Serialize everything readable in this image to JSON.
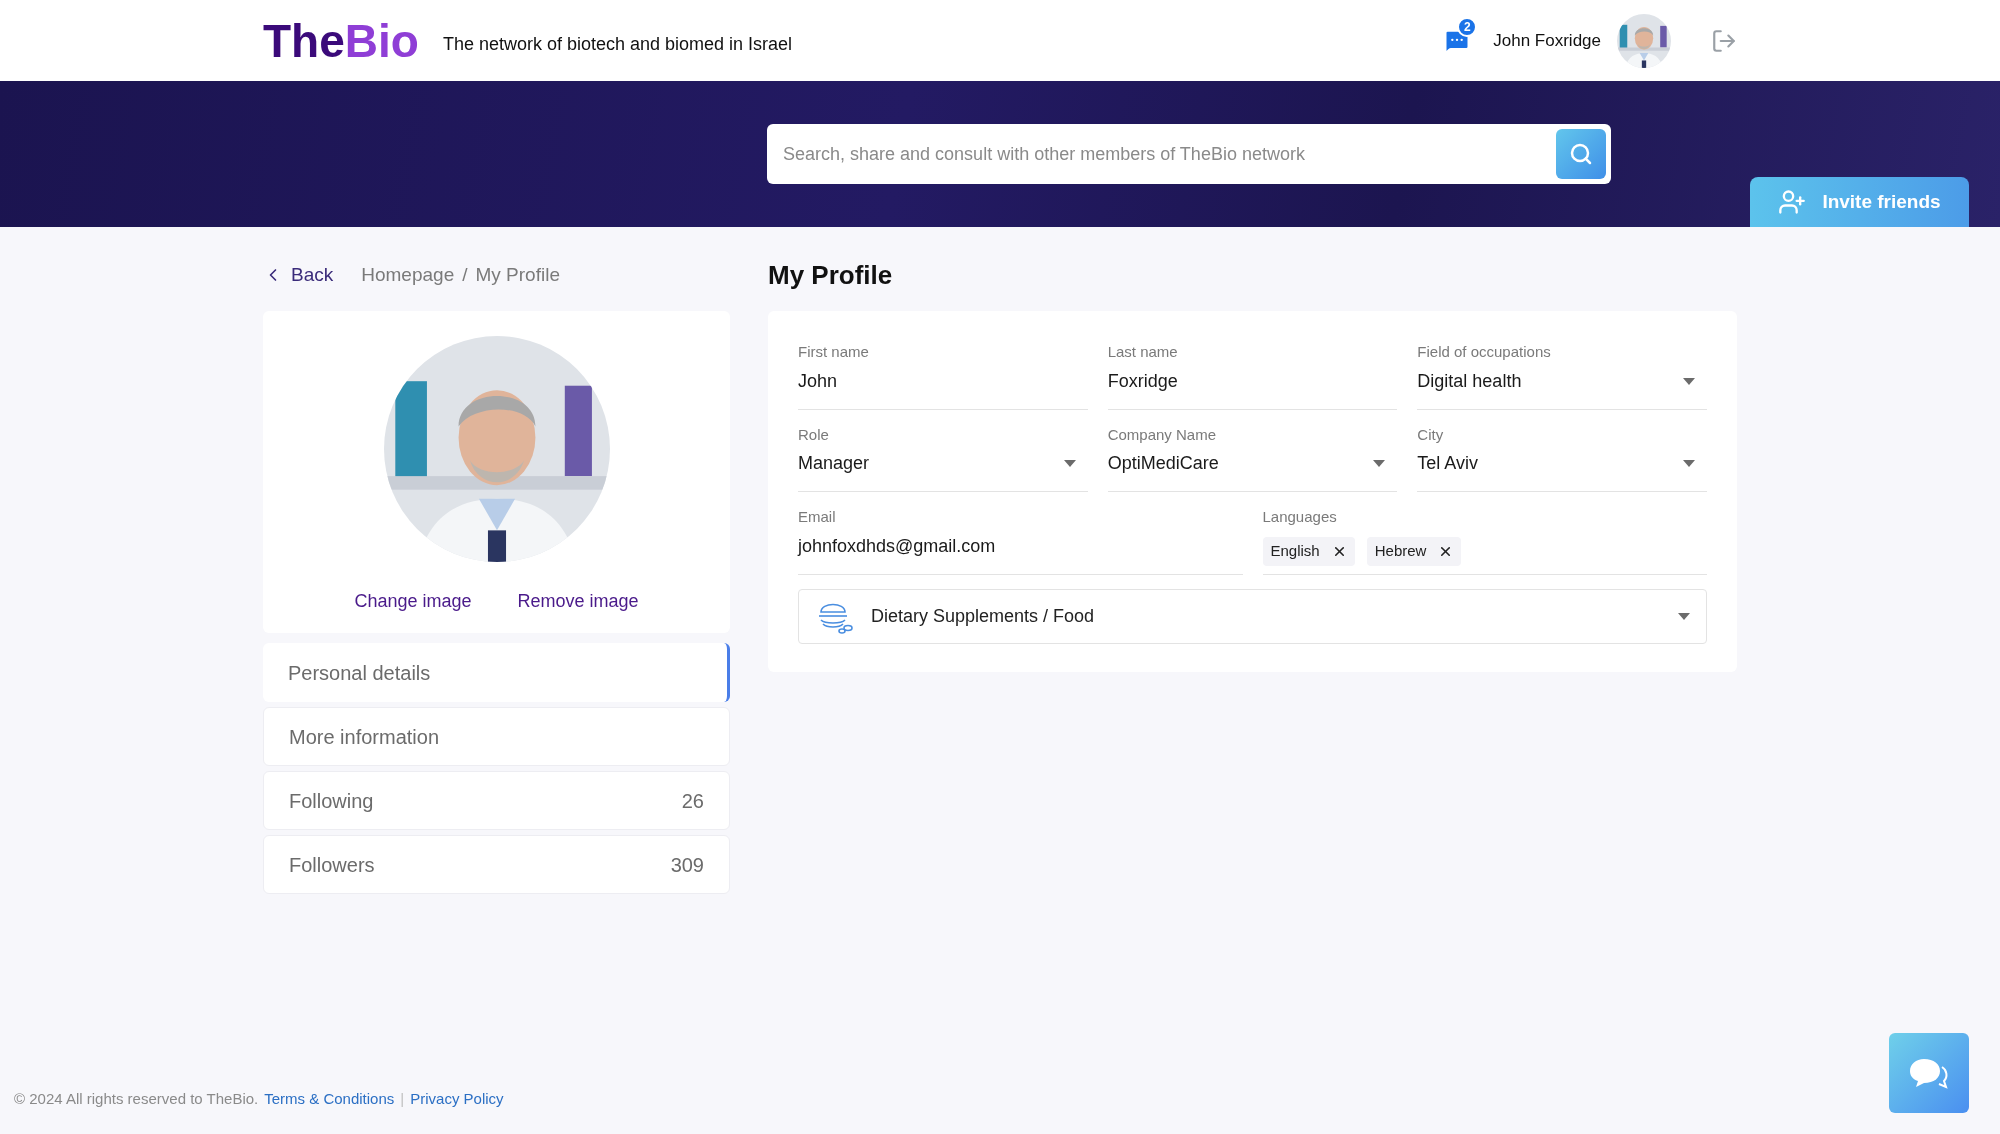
{
  "header": {
    "logo_first": "The",
    "logo_second": "Bio",
    "tagline": "The network of biotech and biomed in Israel",
    "message_count": "2",
    "user_name": "John Foxridge"
  },
  "search": {
    "placeholder": "Search, share and consult with other members of TheBio network"
  },
  "invite_button": "Invite friends",
  "breadcrumb": {
    "back": "Back",
    "items": [
      "Homepage",
      "My Profile"
    ],
    "separator": "/"
  },
  "profile_card": {
    "change_image": "Change image",
    "remove_image": "Remove image"
  },
  "nav": [
    {
      "label": "Personal details",
      "selected": true
    },
    {
      "label": "More information",
      "selected": false
    },
    {
      "label": "Following",
      "count": "26",
      "selected": false
    },
    {
      "label": "Followers",
      "count": "309",
      "selected": false
    }
  ],
  "page_title": "My Profile",
  "form": {
    "rows": [
      [
        {
          "label": "First name",
          "value": "John",
          "kind": "text"
        },
        {
          "label": "Last name",
          "value": "Foxridge",
          "kind": "text"
        },
        {
          "label": "Field of occupations",
          "value": "Digital health",
          "kind": "select"
        }
      ],
      [
        {
          "label": "Role",
          "value": "Manager",
          "kind": "select"
        },
        {
          "label": "Company Name",
          "value": "OptiMediCare",
          "kind": "select"
        },
        {
          "label": "City",
          "value": "Tel Aviv",
          "kind": "select"
        }
      ]
    ],
    "email": {
      "label": "Email",
      "value": "johnfoxdhds@gmail.com"
    },
    "languages": {
      "label": "Languages",
      "chips": [
        "English",
        "Hebrew"
      ]
    },
    "category": {
      "value": "Dietary Supplements / Food"
    }
  },
  "footer": {
    "copyright": "© 2024 All rights reserved to TheBio.",
    "links": [
      "Terms & Conditions",
      "Privacy Policy"
    ],
    "separator": "|"
  }
}
